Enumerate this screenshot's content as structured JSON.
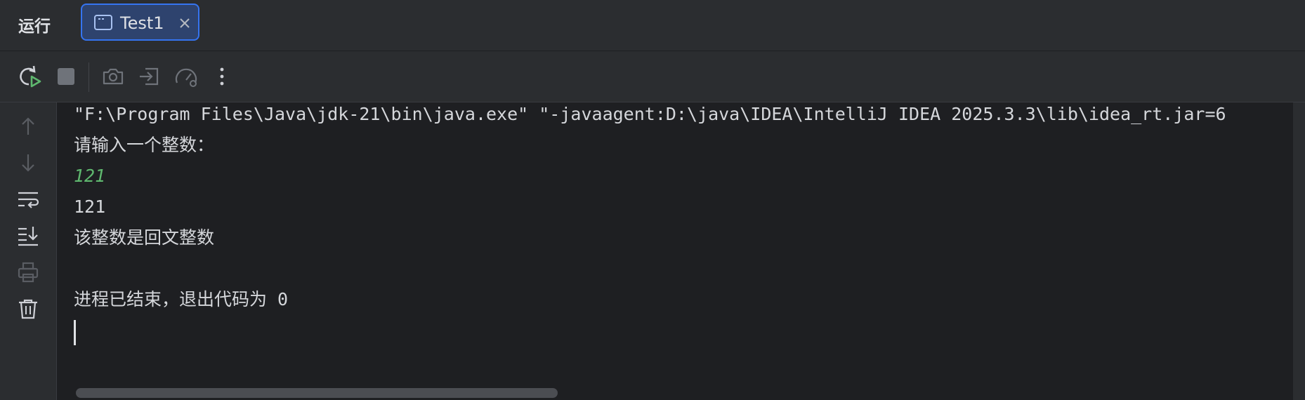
{
  "header": {
    "run_label": "运行",
    "tab": {
      "label": "Test1",
      "icon": "console-window-icon",
      "close_icon": "close-icon"
    }
  },
  "toolbar": {
    "buttons": [
      "rerun-icon",
      "stop-icon",
      "screenshot-icon",
      "import-icon",
      "profiler-icon",
      "more-icon"
    ]
  },
  "sidebar": {
    "buttons": [
      "arrow-up-icon",
      "arrow-down-icon",
      "soft-wrap-icon",
      "scroll-to-end-icon",
      "print-icon",
      "trash-icon"
    ]
  },
  "console": {
    "lines": [
      {
        "text": "\"F:\\Program Files\\Java\\jdk-21\\bin\\java.exe\" \"-javaagent:D:\\java\\IDEA\\IntelliJ IDEA 2025.3.3\\lib\\idea_rt.jar=6",
        "kind": "output"
      },
      {
        "text": "请输入一个整数：",
        "kind": "output"
      },
      {
        "text": "121",
        "kind": "input"
      },
      {
        "text": "121",
        "kind": "output"
      },
      {
        "text": "该整数是回文整数",
        "kind": "output"
      },
      {
        "text": "",
        "kind": "output"
      },
      {
        "text": "进程已结束，退出代码为 0",
        "kind": "output"
      }
    ]
  },
  "colors": {
    "background": "#1e1f22",
    "panel": "#2b2d30",
    "tab_active_bg": "#2e436e",
    "tab_active_border": "#3574f0",
    "text": "#d5d7db",
    "user_input": "#5fb86f",
    "rerun_green": "#5fb86f"
  }
}
